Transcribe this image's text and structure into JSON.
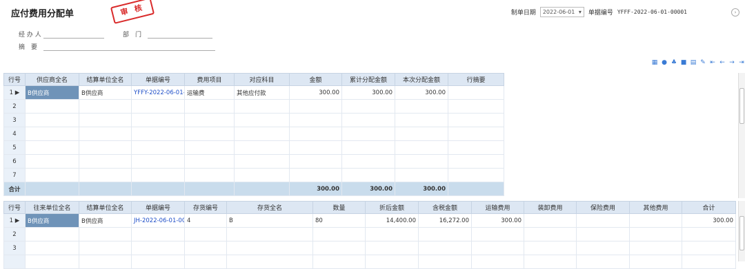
{
  "page": {
    "title": "应付费用分配单",
    "stamp": "审 核",
    "date_label": "制单日期",
    "date_value": "2022-06-01",
    "billno_label": "单据编号",
    "billno_value": "YFFF-2022-06-01-00001"
  },
  "form": {
    "handler_label": "经 办 人",
    "dept_label": "部　门",
    "summary_label": "摘　要"
  },
  "table1": {
    "headers": [
      "行号",
      "供应商全名",
      "结算单位全名",
      "单据编号",
      "费用项目",
      "对应科目",
      "金额",
      "累计分配金额",
      "本次分配金额",
      "行摘要"
    ],
    "rows": [
      {
        "no": "1",
        "c1": "B供应商",
        "c2": "B供应商",
        "c3": "YFFY-2022-06-01-(",
        "c4": "运输费",
        "c5": "其他应付款",
        "c6": "300.00",
        "c7": "300.00",
        "c8": "300.00",
        "c9": ""
      },
      {
        "no": "2"
      },
      {
        "no": "3"
      },
      {
        "no": "4"
      },
      {
        "no": "5"
      },
      {
        "no": "6"
      },
      {
        "no": "7"
      }
    ],
    "total_label": "合计",
    "totals": {
      "amount": "300.00",
      "cum": "300.00",
      "cur": "300.00"
    }
  },
  "table2": {
    "headers": [
      "行号",
      "往来单位全名",
      "结算单位全名",
      "单据编号",
      "存货编号",
      "存货全名",
      "数量",
      "折后金额",
      "含税金额",
      "运输费用",
      "装卸费用",
      "保险费用",
      "其他费用",
      "合计"
    ],
    "rows": [
      {
        "no": "1",
        "c1": "B供应商",
        "c2": "B供应商",
        "c3": "JH-2022-06-01-00(",
        "c4": "4",
        "c5": "B",
        "c6": "80",
        "c7": "14,400.00",
        "c8": "16,272.00",
        "c9": "300.00",
        "c10": "",
        "c11": "",
        "c12": "",
        "c13": "300.00"
      },
      {
        "no": "2"
      },
      {
        "no": "3"
      },
      {
        "no": ""
      }
    ]
  }
}
